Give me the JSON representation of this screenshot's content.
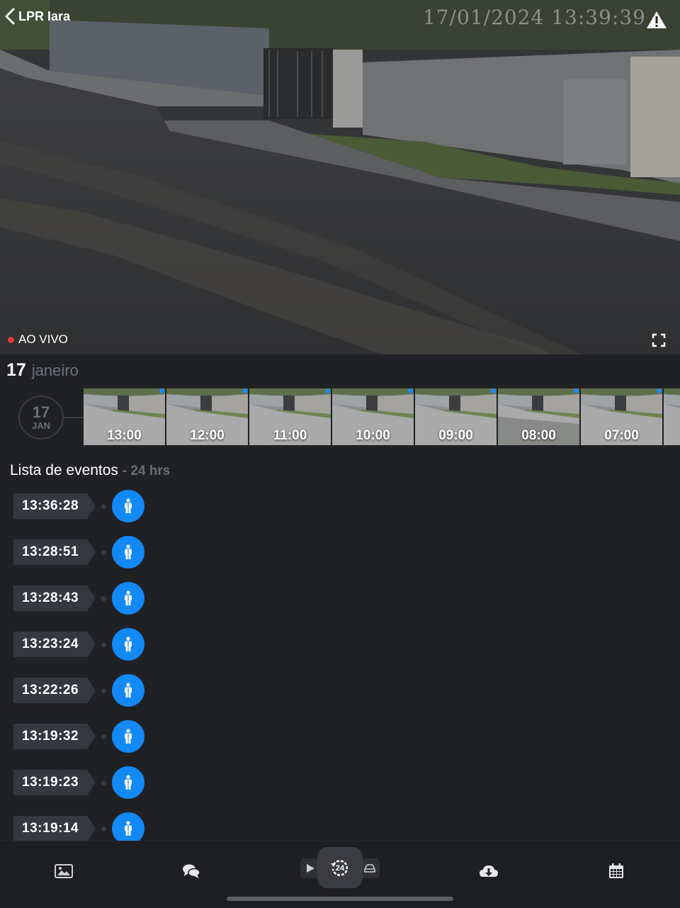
{
  "camera": {
    "title": "LPR Iara",
    "osd_timestamp": "17/01/2024 13:39:39",
    "live_label": "AO VIVO"
  },
  "date_header": {
    "day": "17",
    "month": "janeiro"
  },
  "day_badge": {
    "day": "17",
    "month": "JAN"
  },
  "timeline": [
    {
      "label": "13:00"
    },
    {
      "label": "12:00"
    },
    {
      "label": "11:00"
    },
    {
      "label": "10:00"
    },
    {
      "label": "09:00"
    },
    {
      "label": "08:00"
    },
    {
      "label": "07:00"
    },
    {
      "label": ""
    }
  ],
  "events_section": {
    "title": "Lista de eventos",
    "subtitle": "- 24 hrs"
  },
  "events": [
    {
      "time": "13:36:28",
      "type": "person-icon"
    },
    {
      "time": "13:28:51",
      "type": "person-icon"
    },
    {
      "time": "13:28:43",
      "type": "person-icon"
    },
    {
      "time": "13:23:24",
      "type": "person-icon"
    },
    {
      "time": "13:22:26",
      "type": "person-icon"
    },
    {
      "time": "13:19:32",
      "type": "person-icon"
    },
    {
      "time": "13:19:23",
      "type": "person-icon"
    },
    {
      "time": "13:19:14",
      "type": "person-icon"
    }
  ],
  "bottom_nav": {
    "items": [
      "gallery-icon",
      "chat-icon",
      "play-icon",
      "24h-replay-icon",
      "car-icon",
      "cloud-download-icon",
      "calendar-icon"
    ]
  },
  "colors": {
    "accent": "#1289f5",
    "marker": "#1e88f5",
    "live_dot": "#e53935",
    "background": "#202125"
  }
}
